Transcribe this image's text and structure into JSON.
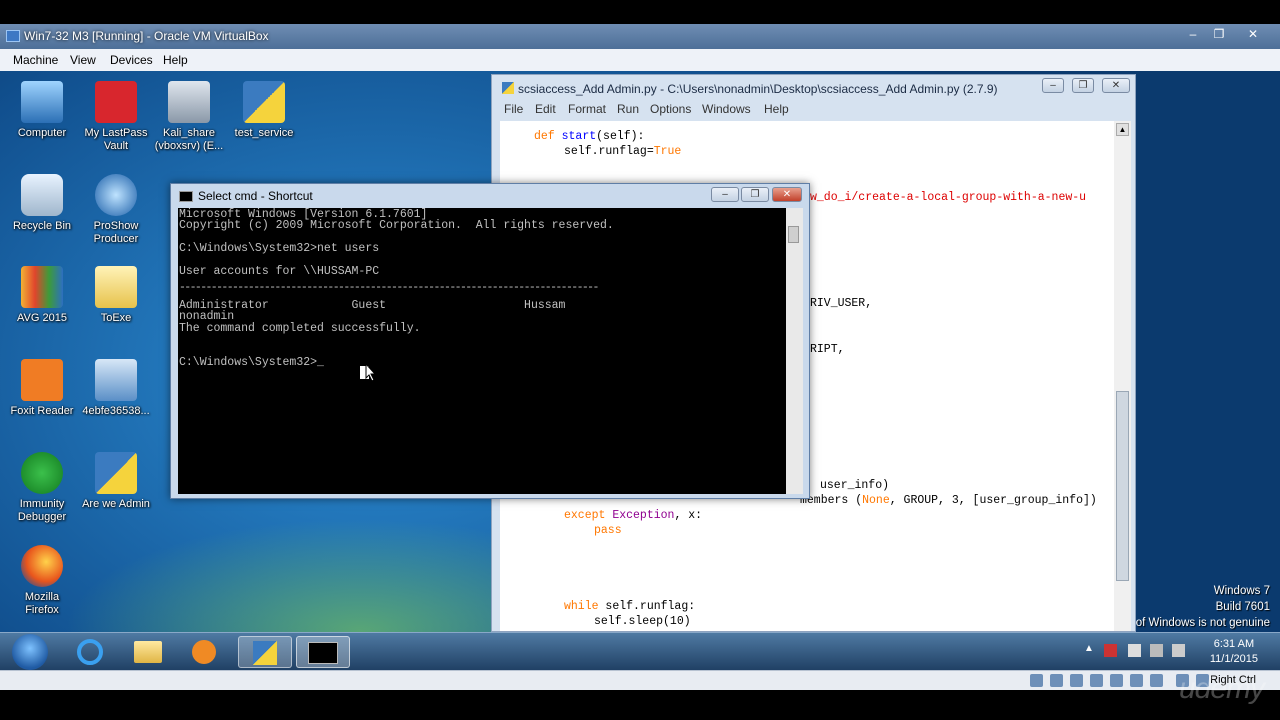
{
  "vbox": {
    "title": "Win7-32 M3 [Running] - Oracle VM VirtualBox",
    "menu": [
      "Machine",
      "View",
      "Devices",
      "Help"
    ],
    "controls": [
      "–",
      "❐",
      "✕"
    ],
    "host_key": "Right Ctrl"
  },
  "desktop": {
    "icons": [
      {
        "label": "Computer"
      },
      {
        "label": "My LastPass Vault"
      },
      {
        "label": "Kali_share (vboxsrv) (E..."
      },
      {
        "label": "test_service"
      },
      {
        "label": "Recycle Bin"
      },
      {
        "label": "ProShow Producer"
      },
      {
        "label": "AVG 2015"
      },
      {
        "label": "ToExe"
      },
      {
        "label": "Foxit Reader"
      },
      {
        "label": "4ebfe36538..."
      },
      {
        "label": "Immunity Debugger"
      },
      {
        "label": "Are we Admin"
      },
      {
        "label": "Mozilla Firefox"
      }
    ],
    "watermark_lines": [
      "Windows 7",
      "Build 7601",
      "of Windows is not genuine"
    ]
  },
  "editor": {
    "title": "scsiaccess_Add Admin.py - C:\\Users\\nonadmin\\Desktop\\scsiaccess_Add Admin.py (2.7.9)",
    "menu": [
      "File",
      "Edit",
      "Format",
      "Run",
      "Options",
      "Windows",
      "Help"
    ],
    "visible_fragments": {
      "def_kw": "def",
      "def_name": "start",
      "def_rest": "(self):",
      "runflag_a": "self.runflag=",
      "true_kw": "True",
      "url_tail": "w_do_i/create-a-local-group-with-a-new-u",
      "priv_user": "RIV_USER,",
      "script": "RIPT,",
      "user_info": "user_info)",
      "members_a": "members (",
      "none_kw": "None",
      "members_b": ", GROUP, 3, [user_group_info])",
      "except_kw": "except",
      "exception_kw": "Exception",
      "except_rest": ", x:",
      "pass_kw": "pass",
      "while_kw": "while",
      "while_rest": " self.runflag:",
      "sleep_line": "self.sleep(10)"
    }
  },
  "cmd": {
    "title": "Select cmd - Shortcut",
    "lines": [
      "Microsoft Windows [Version 6.1.7601]",
      "Copyright (c) 2009 Microsoft Corporation.  All rights reserved.",
      "",
      "C:\\Windows\\System32>net users",
      "",
      "User accounts for \\\\HUSSAM-PC",
      "",
      "-------------------------------------------------------------------------------",
      "Administrator            Guest                    Hussam",
      "nonadmin",
      "The command completed successfully.",
      "",
      "",
      "C:\\Windows\\System32>_"
    ]
  },
  "taskbar": {
    "time": "6:31 AM",
    "date": "11/1/2015"
  },
  "brand_watermark": "udemy"
}
